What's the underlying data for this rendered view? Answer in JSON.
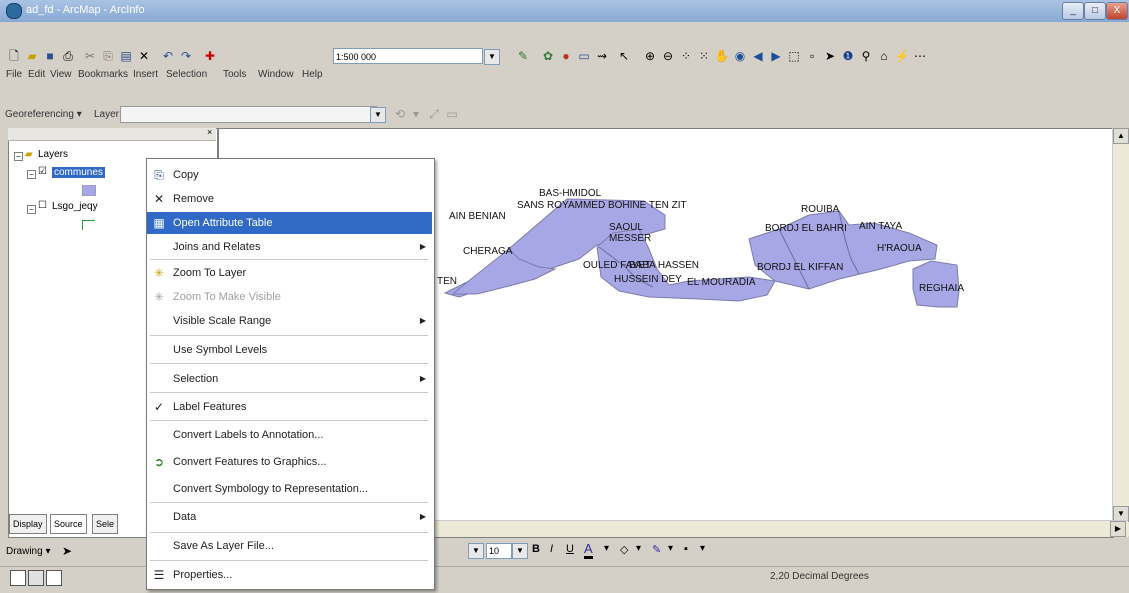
{
  "window": {
    "title": "ad_fd - ArcMap - ArcInfo",
    "minimize": "_",
    "maximize": "□",
    "close": "X"
  },
  "toolbar": {
    "scale_value": "1:500 000"
  },
  "menubar": [
    "File",
    "Edit",
    "View",
    "Bookmarks",
    "Insert",
    "Selection",
    "Tools",
    "Window",
    "Help"
  ],
  "georeferencing": {
    "label": "Georeferencing ▾",
    "layer_label": "Layer:",
    "layer_value": ""
  },
  "toc": {
    "root": "Layers",
    "layer1": "communes",
    "layer2": "Lsgo_jeqy"
  },
  "toc_tabs": [
    "Display",
    "Source",
    "Sele"
  ],
  "map_labels": [
    "BAS-HMIDOL",
    "SANS ROYAMMED BOHINE TEN ZIT",
    "AIN BENIAN",
    "CHERAGA",
    "SAOUL",
    "MESSER",
    "OULED FAYET",
    "BABA HASSEN",
    "HUSSEIN DEY",
    "EL MOURADIA",
    "BORDJ EL BAHRI",
    "BORDJ EL KIFFAN",
    "AIN TAYA",
    "H'RAOUA",
    "ROUIBA",
    "REGHAIA",
    "TEN"
  ],
  "context_menu": [
    {
      "label": "Copy",
      "icon": "copy-icon",
      "glyph": "⎘"
    },
    {
      "label": "Remove",
      "icon": "remove-icon",
      "glyph": "✕"
    },
    {
      "label": "Open Attribute Table",
      "icon": "table-icon",
      "glyph": "▦",
      "highlighted": true
    },
    {
      "label": "Joins and Relates",
      "submenu": true
    },
    {
      "label": "Zoom To Layer",
      "icon": "zoom-layer-icon",
      "glyph": "✳"
    },
    {
      "label": "Zoom To Make Visible",
      "icon": "zoom-visible-icon",
      "glyph": "✳",
      "disabled": true
    },
    {
      "label": "Visible Scale Range",
      "submenu": true
    },
    {
      "label": "Use Symbol Levels"
    },
    {
      "label": "Selection",
      "submenu": true
    },
    {
      "label": "Label Features",
      "icon": "checkmark-icon",
      "glyph": "✓"
    },
    {
      "label": "Convert Labels to Annotation..."
    },
    {
      "label": "Convert Features to Graphics...",
      "icon": "convert-graphics-icon",
      "glyph": "➲"
    },
    {
      "label": "Convert Symbology to Representation..."
    },
    {
      "label": "Data",
      "submenu": true
    },
    {
      "label": "Save As Layer File..."
    },
    {
      "label": "Properties...",
      "icon": "properties-icon",
      "glyph": "☰"
    }
  ],
  "drawing": {
    "label": "Drawing ▾",
    "font_size": "10"
  },
  "status": {
    "coords": "2,20  Decimal Degrees"
  }
}
